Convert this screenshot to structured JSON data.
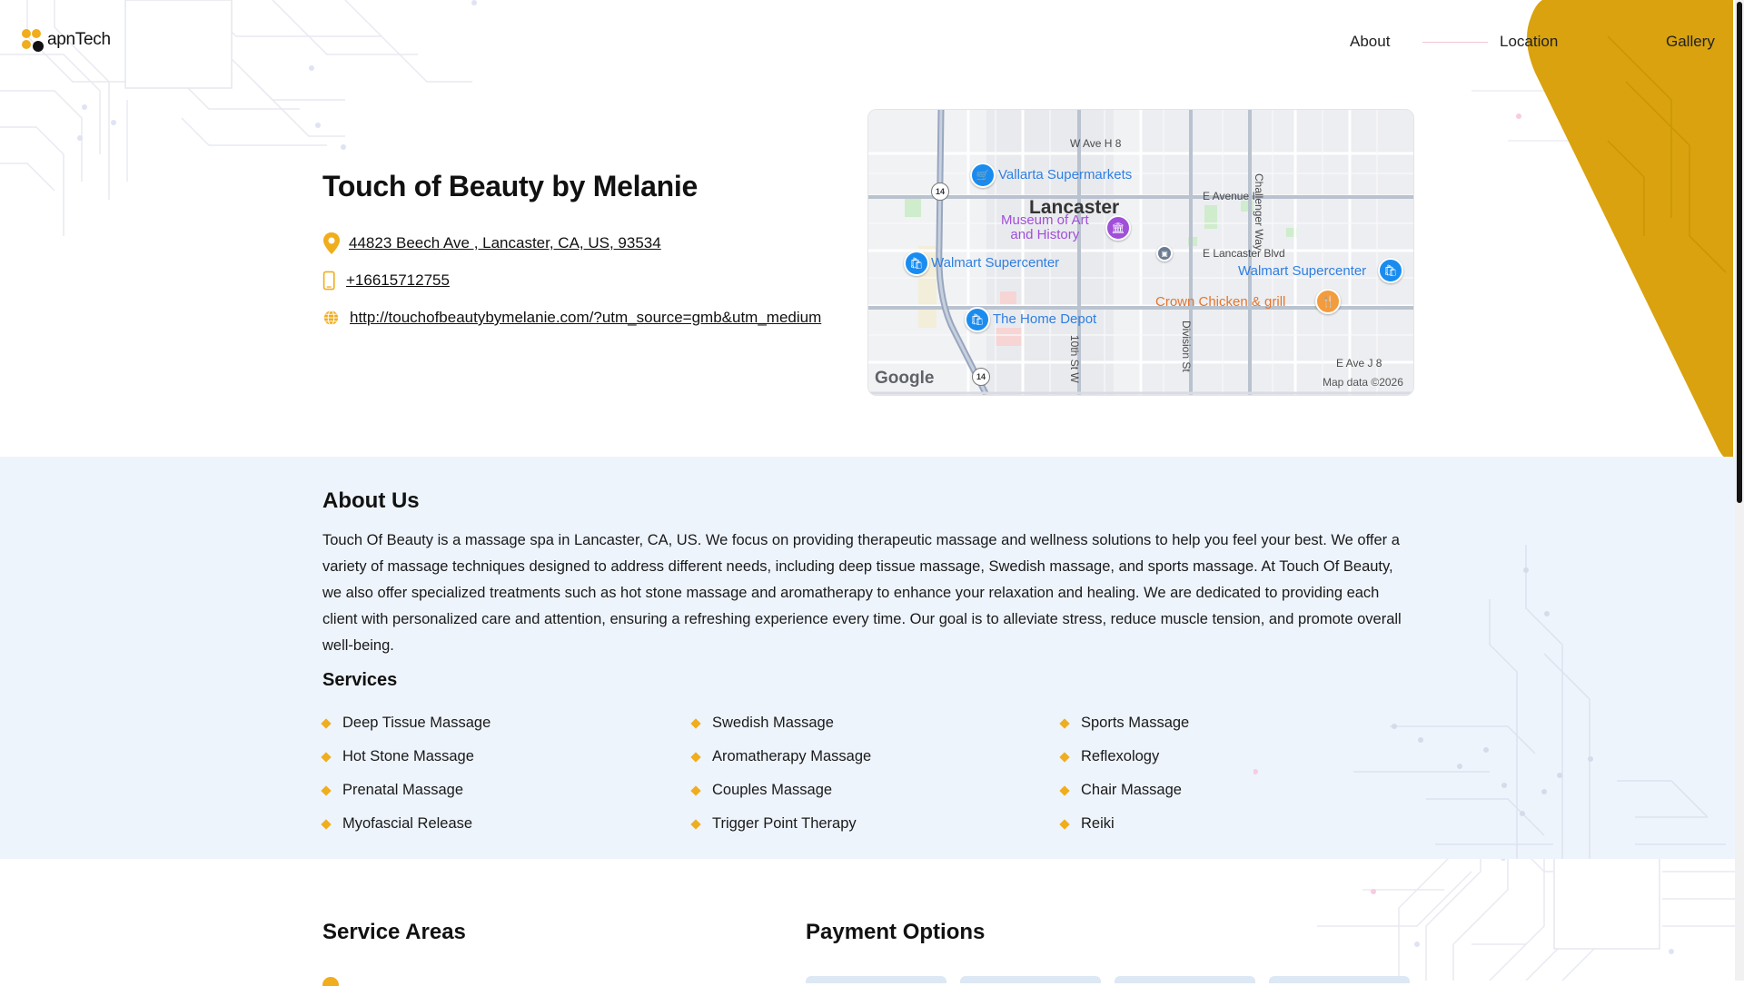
{
  "header": {
    "logo_text": "apnTech",
    "nav": [
      {
        "label": "About"
      },
      {
        "label": "Location"
      },
      {
        "label": "Gallery"
      }
    ]
  },
  "business": {
    "name": "Touch of Beauty by Melanie",
    "address": "44823 Beech Ave , Lancaster, CA, US, 93534",
    "phone": "+16615712755",
    "website": "http://touchofbeautybymelanie.com/?utm_source=gmb&utm_medium"
  },
  "map": {
    "city": "Lancaster",
    "places": {
      "vallarta": "Vallarta Supermarkets",
      "museum": "Museum of Art\nand History",
      "walmart_w": "Walmart Supercenter",
      "walmart_e": "Walmart Supercenter",
      "crown": "Crown Chicken & grill",
      "home_depot": "The Home Depot"
    },
    "roads": {
      "ave_h8": "W Ave H 8",
      "avenue_i": "E Avenue I",
      "lancaster_blvd": "E Lancaster Blvd",
      "challenger": "Challenger Way",
      "division": "Division St",
      "tenth": "10th St W",
      "ave_j8": "E Ave J 8",
      "hwy_14": "14"
    },
    "google": "Google",
    "attribution": "Map data ©2026"
  },
  "about": {
    "heading": "About Us",
    "text": "Touch Of Beauty is a massage spa in Lancaster, CA, US. We focus on providing therapeutic massage and wellness solutions to help you feel your best. We offer a variety of massage techniques designed to address different needs, including deep tissue massage, Swedish massage, and sports massage. At Touch Of Beauty, we also offer specialized treatments such as hot stone massage and aromatherapy to enhance your relaxation and healing. We are dedicated to providing each client with personalized care and attention, ensuring a refreshing experience every time. Our goal is to alleviate stress, reduce muscle tension, and promote overall well-being."
  },
  "services": {
    "heading": "Services",
    "columns": [
      [
        "Deep Tissue Massage",
        "Hot Stone Massage",
        "Prenatal Massage",
        "Myofascial Release"
      ],
      [
        "Swedish Massage",
        "Aromatherapy Massage",
        "Couples Massage",
        "Trigger Point Therapy"
      ],
      [
        "Sports Massage",
        "Reflexology",
        "Chair Massage",
        "Reiki"
      ]
    ]
  },
  "service_areas": {
    "heading": "Service Areas"
  },
  "payment": {
    "heading": "Payment Options"
  },
  "colors": {
    "accent_gold": "#f0ad1c",
    "corner_gold": "#d9a20e",
    "section_bg": "#eef4fc",
    "logo_dark": "#111111"
  },
  "icons": [
    "location-pin-icon",
    "mobile-phone-icon",
    "globe-icon",
    "diamond-bullet-icon"
  ]
}
